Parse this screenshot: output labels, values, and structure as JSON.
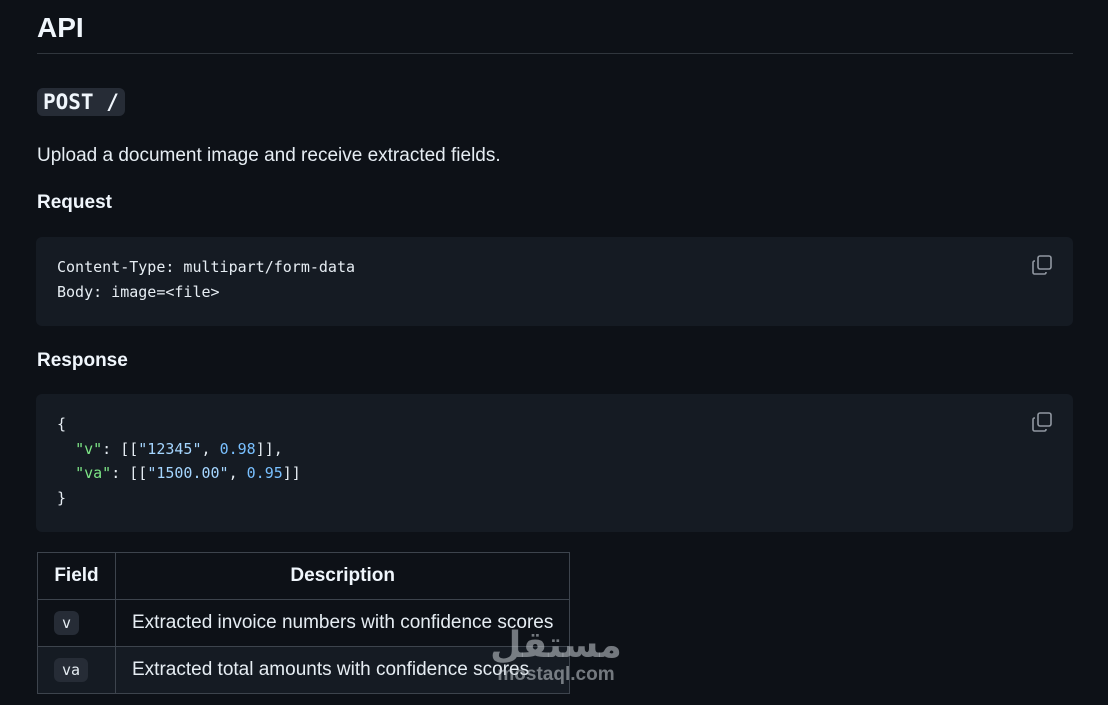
{
  "heading": "API",
  "endpoint": "POST /",
  "intro": "Upload a document image and receive extracted fields.",
  "request": {
    "title": "Request",
    "lines": [
      "Content-Type: multipart/form-data",
      "Body: image=<file>"
    ],
    "copy_icon": "copy-icon"
  },
  "response": {
    "title": "Response",
    "lines": [
      "{",
      "  \"v\": [[\"12345\", 0.98]],",
      "  \"va\": [[\"1500.00\", 0.95]]",
      "}"
    ],
    "copy_icon": "copy-icon"
  },
  "table": {
    "headers": [
      "Field",
      "Description"
    ],
    "rows": [
      {
        "field": "v",
        "description": "Extracted invoice numbers with confidence scores"
      },
      {
        "field": "va",
        "description": "Extracted total amounts with confidence scores"
      }
    ]
  },
  "watermark": {
    "arabic": "مستقل",
    "latin": "mostaql.com"
  },
  "colors": {
    "background": "#0d1117",
    "code_background": "#151b23",
    "border": "#3d444d",
    "json_key": "#7ee787",
    "json_string": "#a5d6ff",
    "json_number": "#79c0ff"
  }
}
